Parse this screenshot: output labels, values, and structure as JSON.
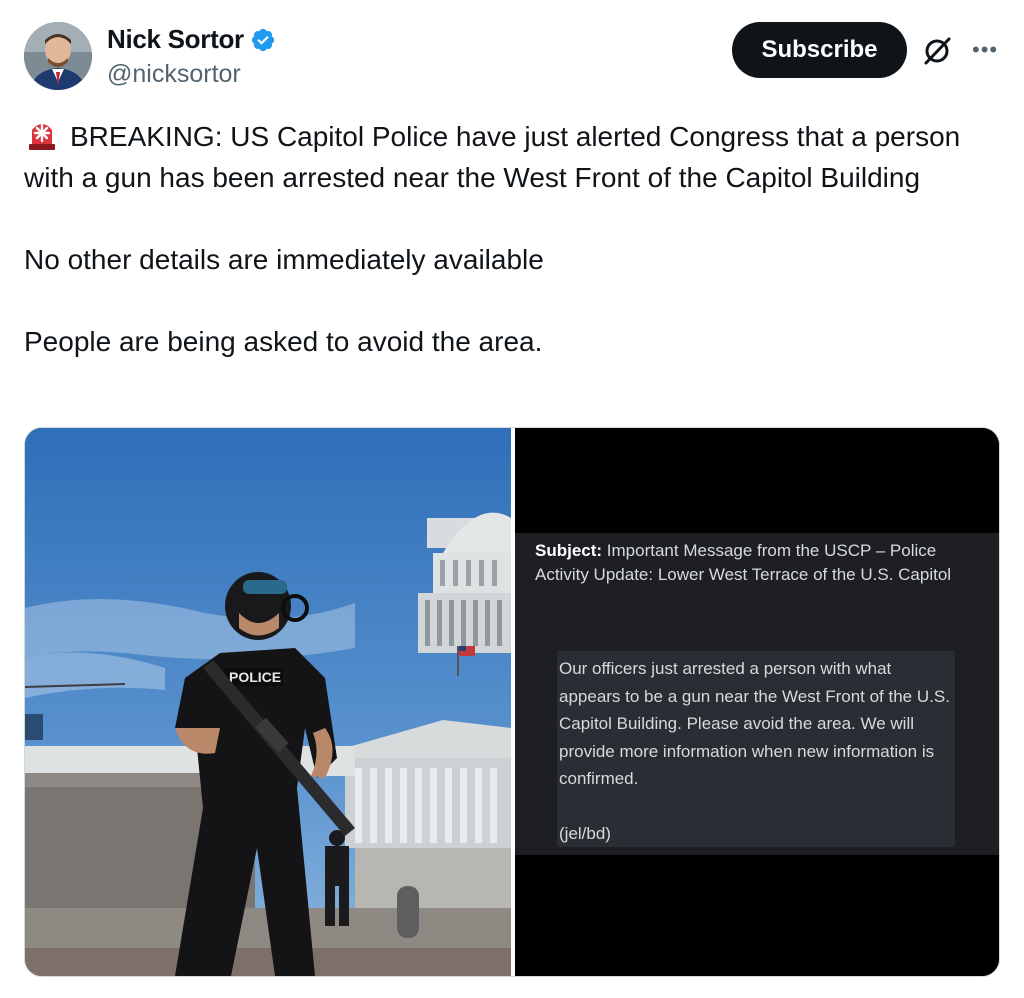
{
  "author": {
    "display_name": "Nick Sortor",
    "handle": "@nicksortor",
    "verified": true
  },
  "actions": {
    "subscribe_label": "Subscribe",
    "more_icon": "ellipsis-icon",
    "grok_icon": "grok-icon"
  },
  "tweet": {
    "siren_icon": "rotating-light-emoji",
    "line1": "BREAKING: US Capitol Police have just alerted Congress that a person with a gun has been arrested near the West Front of the Capitol Building",
    "line2": "No other details are immediately available",
    "line3": "People are being asked to avoid the area."
  },
  "media": {
    "photo_left_vest_text": "POLICE",
    "email": {
      "subject_label": "Subject:",
      "subject_text": "Important Message from the USCP – Police Activity Update: Lower West Terrace of the U.S. Capitol",
      "body": "Our officers just arrested a person with what appears to be a gun near the West Front of the U.S. Capitol Building. Please avoid the area. We will provide more information when new information is confirmed.",
      "signature": "(jel/bd)"
    }
  },
  "colors": {
    "accent": "#1d9bf0",
    "subscribe_bg": "#0f1419",
    "handle": "#536471",
    "email_panel": "#1d1f23",
    "email_body_bg": "#2a2d33"
  }
}
